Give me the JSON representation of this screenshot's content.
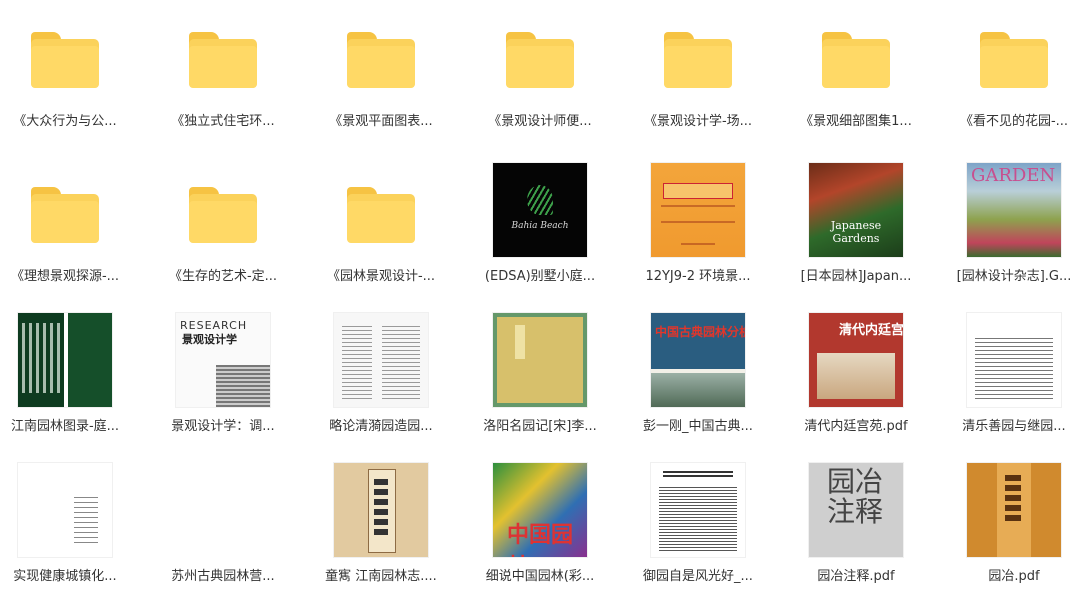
{
  "files": [
    {
      "name": "《大众行为与公...",
      "type": "folder"
    },
    {
      "name": "《独立式住宅环...",
      "type": "folder"
    },
    {
      "name": "《景观平面图表...",
      "type": "folder"
    },
    {
      "name": "《景观设计师便...",
      "type": "folder"
    },
    {
      "name": "《景观设计学-场...",
      "type": "folder"
    },
    {
      "name": "《景观细部图集1...",
      "type": "folder"
    },
    {
      "name": "《看不见的花园-...",
      "type": "folder"
    },
    {
      "name": "《理想景观探源-...",
      "type": "folder"
    },
    {
      "name": "《生存的艺术-定...",
      "type": "folder"
    },
    {
      "name": "《园林景观设计-...",
      "type": "folder"
    },
    {
      "name": "(EDSA)别墅小庭...",
      "type": "pdf",
      "thumb": "black",
      "thumb_text": "Bahia Beach"
    },
    {
      "name": "12YJ9-2 环境景...",
      "type": "pdf",
      "thumb": "orange"
    },
    {
      "name": "[日本园林]Japan...",
      "type": "pdf",
      "thumb": "garden",
      "thumb_text": "Japanese Gardens"
    },
    {
      "name": "[园林设计杂志].G...",
      "type": "pdf",
      "thumb": "mag",
      "thumb_text": "GARDEN"
    },
    {
      "name": "江南园林图录-庭...",
      "type": "pdf",
      "thumb": "green"
    },
    {
      "name": "景观设计学：调...",
      "type": "pdf",
      "thumb": "research",
      "thumb_text": "RESEARCH",
      "thumb_text2": "景观设计学"
    },
    {
      "name": "略论清漪园造园...",
      "type": "pdf",
      "thumb": "paper"
    },
    {
      "name": "洛阳名园记[宋]李...",
      "type": "pdf",
      "thumb": "yellowbook"
    },
    {
      "name": "彭一刚_中国古典...",
      "type": "pdf",
      "thumb": "blue",
      "thumb_text": "中国古典园林分析"
    },
    {
      "name": "清代内廷宫苑.pdf",
      "type": "pdf",
      "thumb": "redbook",
      "thumb_text": "清代内廷宫苑"
    },
    {
      "name": "清乐善园与继园...",
      "type": "pdf",
      "thumb": "text"
    },
    {
      "name": "实现健康城镇化...",
      "type": "pdf",
      "thumb": "sparse"
    },
    {
      "name": "苏州古典园林营...",
      "type": "pdf",
      "thumb": "none"
    },
    {
      "name": "童寯 江南园林志....",
      "type": "pdf",
      "thumb": "scroll"
    },
    {
      "name": "细说中国园林(彩...",
      "type": "pdf",
      "thumb": "colorful",
      "thumb_text": "中国园林"
    },
    {
      "name": "御园自是风光好_...",
      "type": "pdf",
      "thumb": "article"
    },
    {
      "name": "园冶注释.pdf",
      "type": "pdf",
      "thumb": "greybook",
      "thumb_text": "园冶注释"
    },
    {
      "name": "园冶.pdf",
      "type": "pdf",
      "thumb": "oldbook"
    }
  ],
  "colors": {
    "folder": "#ffd966",
    "folder_tab": "#f6c343",
    "label_text": "#333333"
  }
}
